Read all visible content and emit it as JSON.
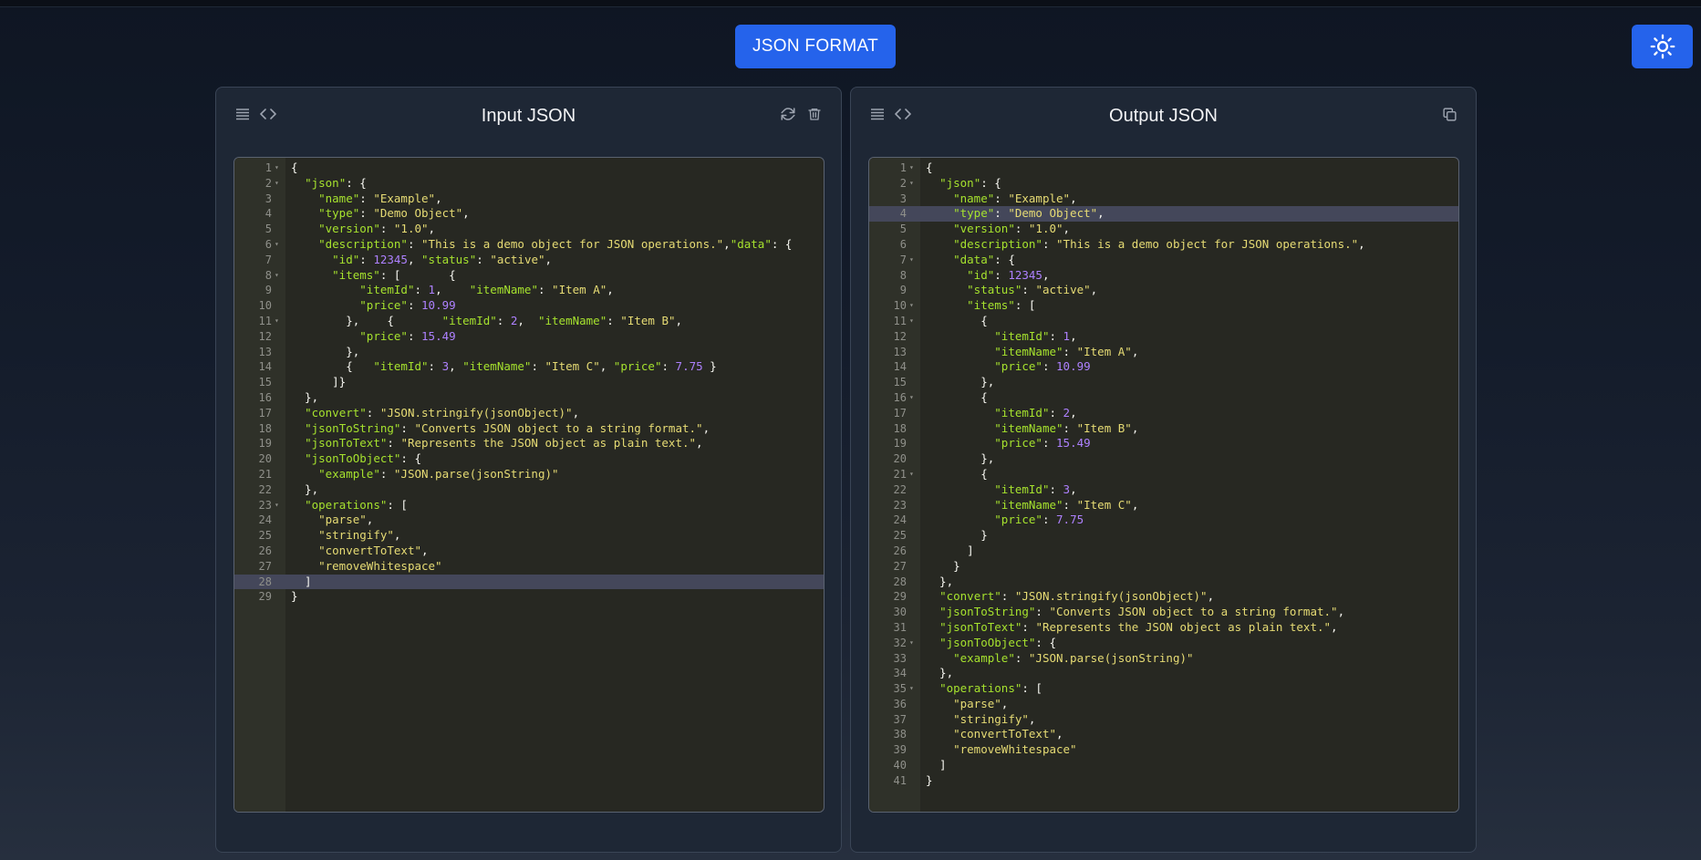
{
  "header": {
    "format_button": "JSON FORMAT",
    "theme_icon": "sun-icon"
  },
  "colors": {
    "accent": "#2563eb",
    "editor_bg": "#272822",
    "key": "#a6e22e",
    "string": "#e6db74",
    "number": "#ae81ff"
  },
  "input_panel": {
    "title": "Input JSON",
    "icons": [
      "list-icon",
      "code-icon",
      "refresh-icon",
      "trash-icon"
    ],
    "active_line": 28,
    "lines": [
      "{",
      "  \"json\": {",
      "    \"name\": \"Example\",",
      "    \"type\": \"Demo Object\",",
      "    \"version\": \"1.0\",",
      "    \"description\": \"This is a demo object for JSON operations.\",\"data\": {",
      "      \"id\": 12345, \"status\": \"active\",",
      "      \"items\": [       {",
      "          \"itemId\": 1,    \"itemName\": \"Item A\",",
      "          \"price\": 10.99",
      "        },    {       \"itemId\": 2,  \"itemName\": \"Item B\",",
      "          \"price\": 15.49",
      "        },",
      "        {   \"itemId\": 3, \"itemName\": \"Item C\", \"price\": 7.75 }",
      "      ]}",
      "  },",
      "  \"convert\": \"JSON.stringify(jsonObject)\",",
      "  \"jsonToString\": \"Converts JSON object to a string format.\",",
      "  \"jsonToText\": \"Represents the JSON object as plain text.\",",
      "  \"jsonToObject\": {",
      "    \"example\": \"JSON.parse(jsonString)\"",
      "  },",
      "  \"operations\": [",
      "    \"parse\",",
      "    \"stringify\",",
      "    \"convertToText\",",
      "    \"removeWhitespace\"",
      "  ]",
      "}"
    ],
    "folds": [
      1,
      2,
      6,
      8,
      11,
      23
    ]
  },
  "output_panel": {
    "title": "Output JSON",
    "icons": [
      "list-icon",
      "code-icon",
      "copy-icon"
    ],
    "active_line": 4,
    "lines": [
      "{",
      "  \"json\": {",
      "    \"name\": \"Example\",",
      "    \"type\": \"Demo Object\",",
      "    \"version\": \"1.0\",",
      "    \"description\": \"This is a demo object for JSON operations.\",",
      "    \"data\": {",
      "      \"id\": 12345,",
      "      \"status\": \"active\",",
      "      \"items\": [",
      "        {",
      "          \"itemId\": 1,",
      "          \"itemName\": \"Item A\",",
      "          \"price\": 10.99",
      "        },",
      "        {",
      "          \"itemId\": 2,",
      "          \"itemName\": \"Item B\",",
      "          \"price\": 15.49",
      "        },",
      "        {",
      "          \"itemId\": 3,",
      "          \"itemName\": \"Item C\",",
      "          \"price\": 7.75",
      "        }",
      "      ]",
      "    }",
      "  },",
      "  \"convert\": \"JSON.stringify(jsonObject)\",",
      "  \"jsonToString\": \"Converts JSON object to a string format.\",",
      "  \"jsonToText\": \"Represents the JSON object as plain text.\",",
      "  \"jsonToObject\": {",
      "    \"example\": \"JSON.parse(jsonString)\"",
      "  },",
      "  \"operations\": [",
      "    \"parse\",",
      "    \"stringify\",",
      "    \"convertToText\",",
      "    \"removeWhitespace\"",
      "  ]",
      "}"
    ],
    "folds": [
      1,
      2,
      7,
      10,
      11,
      16,
      21,
      32,
      35
    ]
  }
}
